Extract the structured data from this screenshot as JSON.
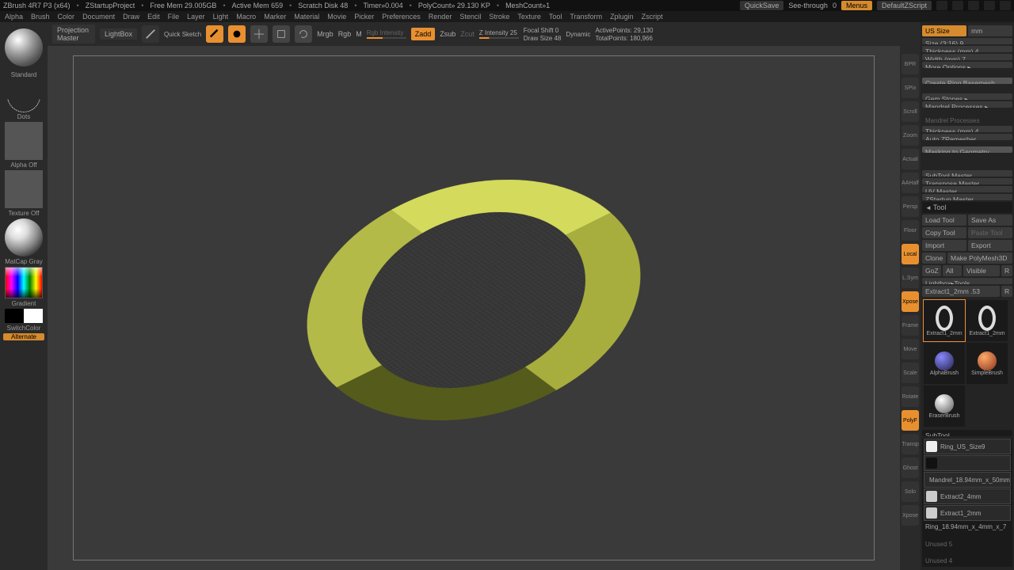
{
  "title": {
    "app": "ZBrush 4R7 P3 (x64)",
    "proj": "ZStartupProject",
    "mem": "Free Mem 29.005GB",
    "active": "Active Mem 659",
    "scratch": "Scratch Disk 48",
    "timer": "Timer»0.004",
    "poly": "PolyCount» 29.130 KP",
    "mesh": "MeshCount»1"
  },
  "titlebar_right": {
    "quicksave": "QuickSave",
    "see": "See-through",
    "see_v": "0",
    "menus": "Menus",
    "script": "DefaultZScript"
  },
  "menu": [
    "Alpha",
    "Brush",
    "Color",
    "Document",
    "Draw",
    "Edit",
    "File",
    "Layer",
    "Light",
    "Macro",
    "Marker",
    "Material",
    "Movie",
    "Picker",
    "Preferences",
    "Render",
    "Stencil",
    "Stroke",
    "Texture",
    "Tool",
    "Transform",
    "Zplugin",
    "Zscript"
  ],
  "shelf": {
    "proj": "Projection Master",
    "lightbox": "LightBox",
    "qs": "Quick Sketch",
    "edit": "Edit",
    "draw": "Draw",
    "move": "Move",
    "scale": "Scale",
    "rotate": "Rotate",
    "mrgb": "Mrgb",
    "rgb": "Rgb",
    "m": "M",
    "rgbint": "Rgb Intensity",
    "zadd": "Zadd",
    "zsub": "Zsub",
    "zcut": "Zcut",
    "zint": "Z Intensity 25",
    "focal": "Focal Shift 0",
    "drawsize": "Draw Size 48",
    "dynamic": "Dynamic",
    "active": "ActivePoints: 29,130",
    "total": "TotalPoints: 180,966"
  },
  "left": {
    "standard": "Standard",
    "dots": "Dots",
    "alpha": "Alpha Off",
    "texture": "Texture Off",
    "matcap": "MatCap Gray",
    "gradient": "Gradient",
    "switch": "SwitchColor",
    "alternate": "Alternate"
  },
  "ricons": [
    "BPR",
    "SPix",
    "Scroll",
    "Zoom",
    "Actual",
    "AAHalf",
    "Persp",
    "Floor",
    "Local",
    "L.Sym",
    "Xpose",
    "Frame",
    "Move",
    "Scale",
    "Rotate",
    "PolyF",
    "Transp",
    "Ghost",
    "Solo",
    "Xpose"
  ],
  "r2": {
    "us": "US Size",
    "mm": "mm",
    "size": "Size (3:16) 9",
    "thk": "Thickness (mm) 4",
    "width": "Width (mm) 7",
    "more": "More Options ▸",
    "create": "Create Ring Basemesh",
    "gem": "Gem Stones ▸",
    "mandrel": "Mandrel Processes ▸",
    "mproc": "Mandrel Processes",
    "thk2": "Thickness (mm) 4",
    "autoz": "Auto ZRemesher",
    "mask": "Masking to Geometry",
    "stm": "SubTool Master",
    "tpm": "Transpose Master",
    "uvm": "UV Master",
    "zsm": "ZStartup Master",
    "tool": "Tool",
    "load": "Load Tool",
    "save": "Save As",
    "copy": "Copy Tool",
    "paste": "Paste Tool",
    "import": "Import",
    "export": "Export",
    "clone": "Clone",
    "make": "Make PolyMesh3D",
    "goz": "GoZ",
    "all": "All",
    "visible": "Visible",
    "r": "R",
    "lbox": "Lightbox▸Tools",
    "curtool": "Extract1_2mm .53",
    "r2": "R",
    "thumbs": [
      {
        "n": "Extract1_2mm"
      },
      {
        "n": "Extract1_2mm"
      },
      {
        "n": "AlphaBrush"
      },
      {
        "n": "SimpleBrush"
      },
      {
        "n": "EraserBrush"
      }
    ],
    "subtool": "SubTool",
    "st": [
      {
        "n": "Ring_US_Size9"
      },
      {
        "n": ""
      },
      {
        "n": "Mandrel_18.94mm_x_50mm"
      },
      {
        "n": "Extract2_4mm"
      },
      {
        "n": "Extract1_2mm"
      },
      {
        "n": "Ring_18.94mm_x_4mm_x_7"
      }
    ],
    "unused1": "Unused 5",
    "unused2": "Unused 4"
  }
}
